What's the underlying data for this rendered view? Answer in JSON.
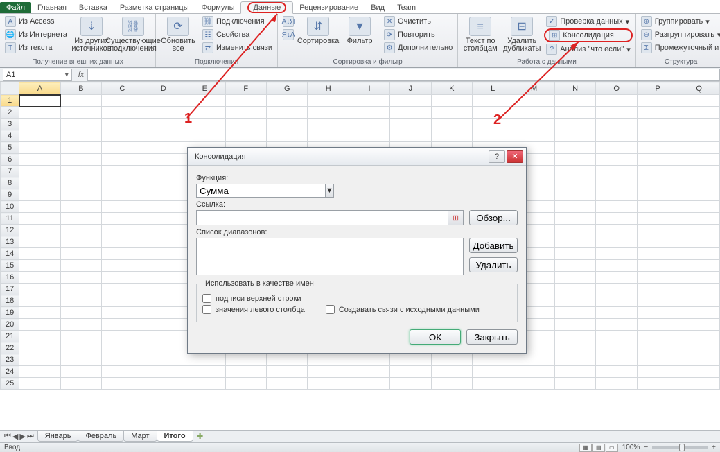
{
  "tabs": {
    "file": "Файл",
    "items": [
      "Главная",
      "Вставка",
      "Разметка страницы",
      "Формулы",
      "Данные",
      "Рецензирование",
      "Вид",
      "Team"
    ],
    "active": "Данные"
  },
  "ribbon": {
    "g1": {
      "label": "Получение внешних данных",
      "access": "Из Access",
      "web": "Из Интернета",
      "text": "Из текста",
      "other": "Из других источников",
      "existing": "Существующие подключения"
    },
    "g2": {
      "label": "Подключения",
      "refresh": "Обновить все",
      "conns": "Подключения",
      "props": "Свойства",
      "links": "Изменить связи"
    },
    "g3": {
      "label": "Сортировка и фильтр",
      "az": "А↓Я",
      "za": "Я↓А",
      "sort": "Сортировка",
      "filter": "Фильтр",
      "clear": "Очистить",
      "reapply": "Повторить",
      "adv": "Дополнительно"
    },
    "g4": {
      "label": "Работа с данными",
      "ttc": "Текст по столбцам",
      "dedup": "Удалить дубликаты",
      "valid": "Проверка данных",
      "consol": "Консолидация",
      "whatif": "Анализ \"что если\""
    },
    "g5": {
      "label": "Структура",
      "group": "Группировать",
      "ungroup": "Разгруппировать",
      "subtotal": "Промежуточный и"
    }
  },
  "namebox": "A1",
  "fx": "fx",
  "cols": [
    "A",
    "B",
    "C",
    "D",
    "E",
    "F",
    "G",
    "H",
    "I",
    "J",
    "K",
    "L",
    "M",
    "N",
    "O",
    "P",
    "Q"
  ],
  "rows": 25,
  "selected": "A1",
  "sheets": {
    "items": [
      "Январь",
      "Февраль",
      "Март",
      "Итого"
    ],
    "active": "Итого"
  },
  "status": {
    "mode": "Ввод",
    "zoom": "100%",
    "minus": "−",
    "plus": "+"
  },
  "dialog": {
    "title": "Консолидация",
    "help": "?",
    "close": "✕",
    "func_label": "Функция:",
    "func_value": "Сумма",
    "ref_label": "Ссылка:",
    "ref_value": "",
    "refpick": "⊞",
    "browse": "Обзор...",
    "list_label": "Список диапазонов:",
    "add": "Добавить",
    "delete": "Удалить",
    "legend": "Использовать в качестве имен",
    "top": "подписи верхней строки",
    "left": "значения левого столбца",
    "links": "Создавать связи с исходными данными",
    "ok": "ОК",
    "cancel": "Закрыть"
  },
  "annot": {
    "one": "1",
    "two": "2"
  }
}
